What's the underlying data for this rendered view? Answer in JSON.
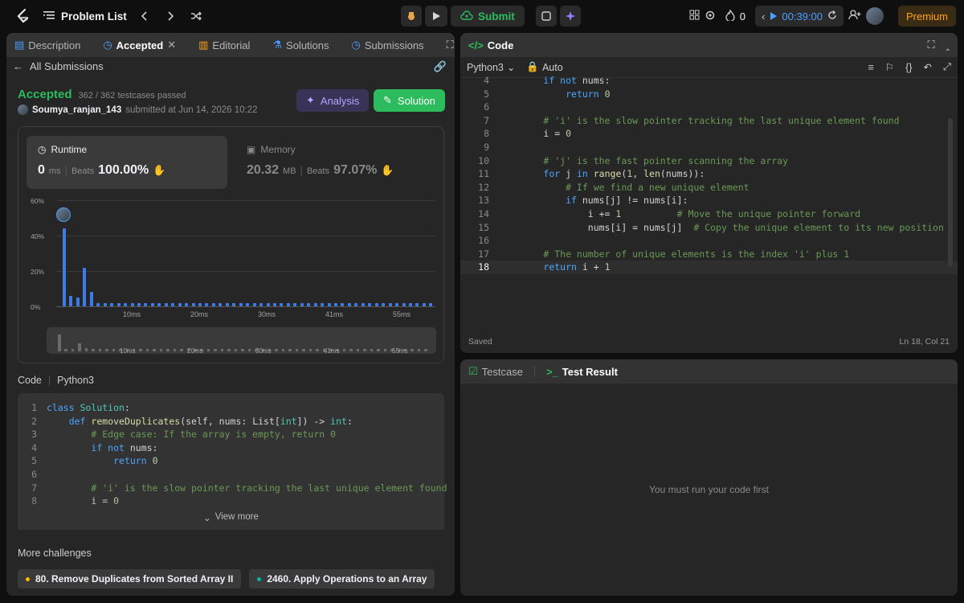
{
  "nav": {
    "problem_list": "Problem List",
    "submit": "Submit",
    "flame_count": "0",
    "timer": "00:39:00",
    "premium": "Premium"
  },
  "left": {
    "tabs": {
      "description": "Description",
      "accepted": "Accepted",
      "editorial": "Editorial",
      "solutions": "Solutions",
      "submissions": "Submissions"
    },
    "back_label": "All Submissions",
    "status": "Accepted",
    "testcases": "362 / 362 testcases passed",
    "username": "Soumya_ranjan_143",
    "submitted": "submitted at Jun 14, 2026 10:22",
    "analysis_btn": "Analysis",
    "solution_btn": "Solution",
    "runtime": {
      "label": "Runtime",
      "value": "0",
      "unit": "ms",
      "beats_label": "Beats",
      "beats": "100.00%"
    },
    "memory": {
      "label": "Memory",
      "value": "20.32",
      "unit": "MB",
      "beats_label": "Beats",
      "beats": "97.07%"
    },
    "code_label": "Code",
    "code_lang": "Python3",
    "view_more": "View more",
    "more_challenges": "More challenges",
    "challenges": [
      {
        "title": "80. Remove Duplicates from Sorted Array II",
        "color": "#ffb800"
      },
      {
        "title": "2460. Apply Operations to an Array",
        "color": "#00b8a3"
      }
    ]
  },
  "chart_data": {
    "type": "bar",
    "yticks": [
      "60%",
      "40%",
      "20%",
      "0%"
    ],
    "xticks": [
      "10ms",
      "20ms",
      "30ms",
      "41ms",
      "55ms"
    ],
    "ylim": [
      0,
      60
    ],
    "values": [
      44,
      6,
      5,
      22,
      8,
      2,
      2,
      2,
      2,
      2,
      2,
      2,
      2,
      2,
      2,
      2,
      2,
      2,
      2,
      2,
      2,
      2,
      2,
      2,
      2,
      2,
      2,
      2,
      2,
      2,
      2,
      2,
      2,
      2,
      2,
      2,
      2,
      2,
      2,
      2,
      2,
      2,
      2,
      2,
      2,
      2,
      2,
      2,
      2,
      2,
      2,
      2,
      2,
      2,
      2
    ]
  },
  "editor": {
    "title": "Code",
    "lang": "Python3",
    "mode": "Auto",
    "saved": "Saved",
    "cursor": "Ln 18, Col 21"
  },
  "bottom": {
    "testcase_tab": "Testcase",
    "result_tab": "Test Result",
    "empty_msg": "You must run your code first"
  }
}
